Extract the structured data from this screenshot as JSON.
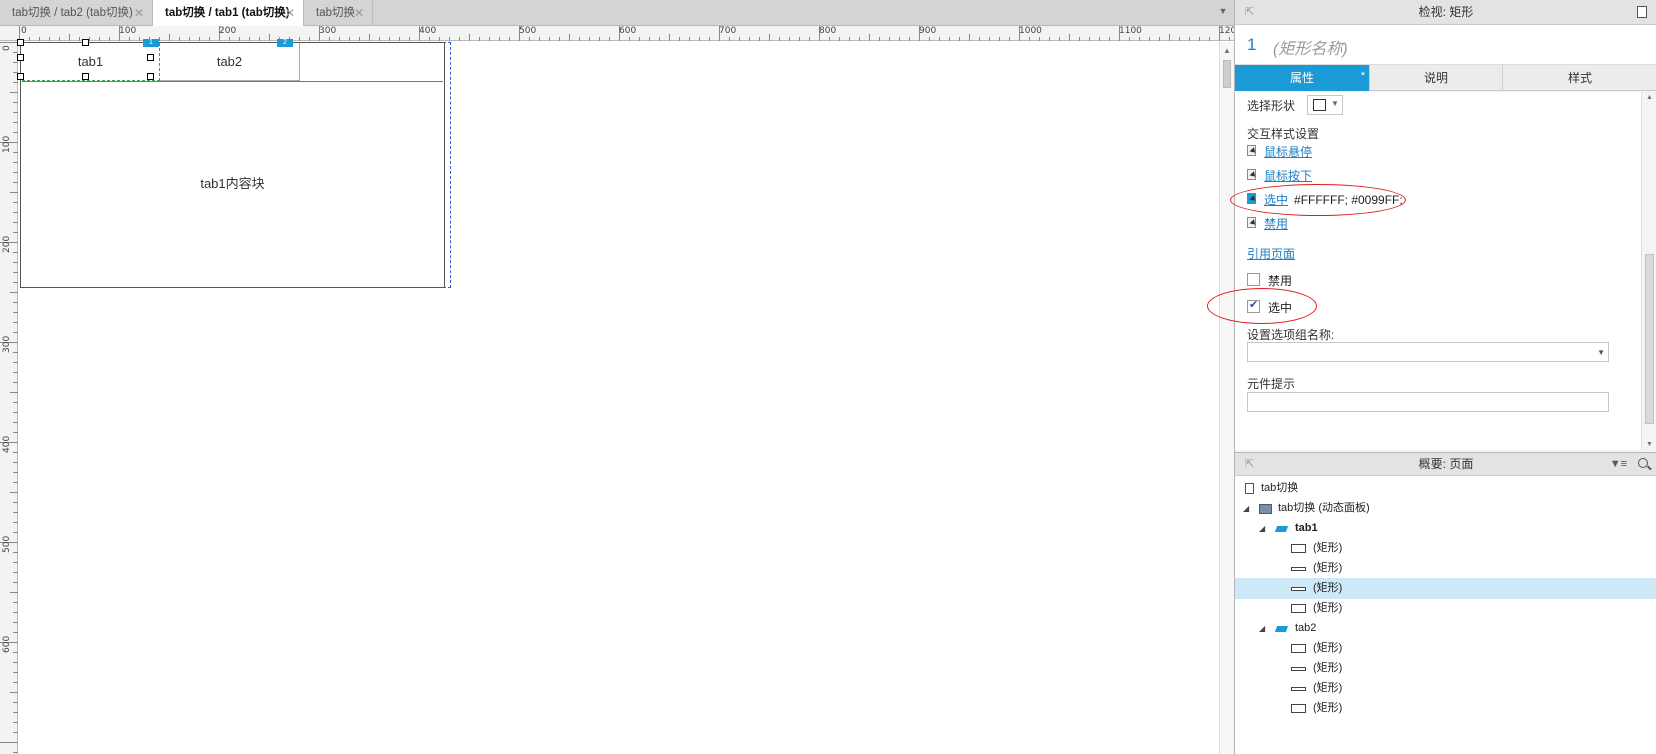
{
  "tabs": [
    {
      "label": "tab切换 / tab2 (tab切换)",
      "active": false
    },
    {
      "label": "tab切换 / tab1 (tab切换)",
      "active": true
    },
    {
      "label": "tab切换",
      "active": false
    }
  ],
  "ruler": {
    "h_labels": [
      "0",
      "100",
      "200",
      "300",
      "400",
      "500",
      "600",
      "700",
      "800",
      "900",
      "1000",
      "1100",
      "120"
    ],
    "v_labels": [
      "0",
      "100",
      "200",
      "300",
      "400",
      "500",
      "600"
    ]
  },
  "canvas": {
    "tab1_label": "tab1",
    "tab2_label": "tab2",
    "badge1": "1",
    "badge2": "2",
    "content_label": "tab1内容块"
  },
  "inspector": {
    "title": "检视: 矩形",
    "shape_number": "1",
    "shape_name": "(矩形名称)",
    "tabs": [
      {
        "label": "属性",
        "active": true,
        "modified_mark": "*"
      },
      {
        "label": "说明",
        "active": false
      },
      {
        "label": "样式",
        "active": false
      }
    ],
    "select_shape_label": "选择形状",
    "interaction_styles_title": "交互样式设置",
    "interaction_styles": [
      {
        "label": "鼠标悬停",
        "value": ""
      },
      {
        "label": "鼠标按下",
        "value": ""
      },
      {
        "label": "选中",
        "value": "#FFFFFF; #0099FF;"
      },
      {
        "label": "禁用",
        "value": ""
      }
    ],
    "reference_page": "引用页面",
    "disabled_label": "禁用",
    "disabled_checked": false,
    "selected_label": "选中",
    "selected_checked": true,
    "group_name_label": "设置选项组名称:",
    "group_name_value": "",
    "tooltip_label": "元件提示",
    "tooltip_value": ""
  },
  "outline": {
    "title": "概要: 页面",
    "items": [
      {
        "label": "tab切换",
        "type": "page",
        "level": 0
      },
      {
        "label": "tab切换 (动态面板)",
        "type": "dynamic-panel",
        "level": 0
      },
      {
        "label": "tab1",
        "type": "state",
        "level": 1
      },
      {
        "label": "(矩形)",
        "type": "rect",
        "level": 2
      },
      {
        "label": "(矩形)",
        "type": "line",
        "level": 2
      },
      {
        "label": "(矩形)",
        "type": "line",
        "level": 2,
        "selected": true
      },
      {
        "label": "(矩形)",
        "type": "rect",
        "level": 2
      },
      {
        "label": "tab2",
        "type": "state",
        "level": 1
      },
      {
        "label": "(矩形)",
        "type": "rect",
        "level": 2
      },
      {
        "label": "(矩形)",
        "type": "line",
        "level": 2
      },
      {
        "label": "(矩形)",
        "type": "line",
        "level": 2
      },
      {
        "label": "(矩形)",
        "type": "rect",
        "level": 2
      }
    ]
  }
}
